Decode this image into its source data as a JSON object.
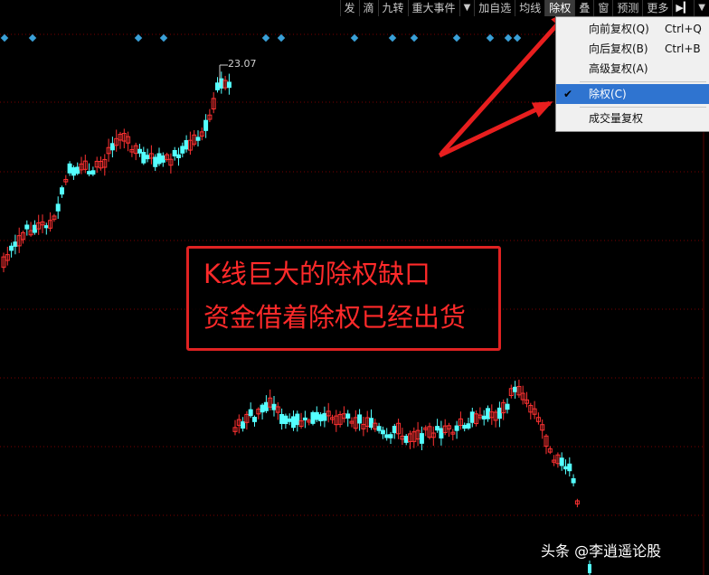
{
  "toolbar": {
    "items": [
      "发",
      "滴",
      "九转",
      "重大事件",
      "加自选",
      "均线",
      "除权",
      "叠",
      "窗",
      "预测",
      "更多"
    ],
    "active_item": "除权"
  },
  "menu": {
    "items": [
      {
        "label": "向前复权(Q)",
        "shortcut": "Ctrl+Q",
        "checked": false,
        "selected": false
      },
      {
        "label": "向后复权(B)",
        "shortcut": "Ctrl+B",
        "checked": false,
        "selected": false
      },
      {
        "label": "高级复权(A)",
        "shortcut": "",
        "checked": false,
        "selected": false
      },
      {
        "label": "除权(C)",
        "shortcut": "",
        "checked": true,
        "selected": true
      },
      {
        "label": "成交量复权",
        "shortcut": "",
        "checked": false,
        "selected": false
      }
    ],
    "check_mark": "✔"
  },
  "chart": {
    "high_label": "23.07",
    "colors": {
      "up": "#ff3232",
      "down": "#54ffff",
      "grid": "#7a0000",
      "dividend_marker": "#3aa0d8",
      "arrow": "#e81e1e"
    }
  },
  "annotation": {
    "line1": "K线巨大的除权缺口",
    "line2": "资金借着除权已经出货"
  },
  "watermark": "头条 @李逍遥论股"
}
